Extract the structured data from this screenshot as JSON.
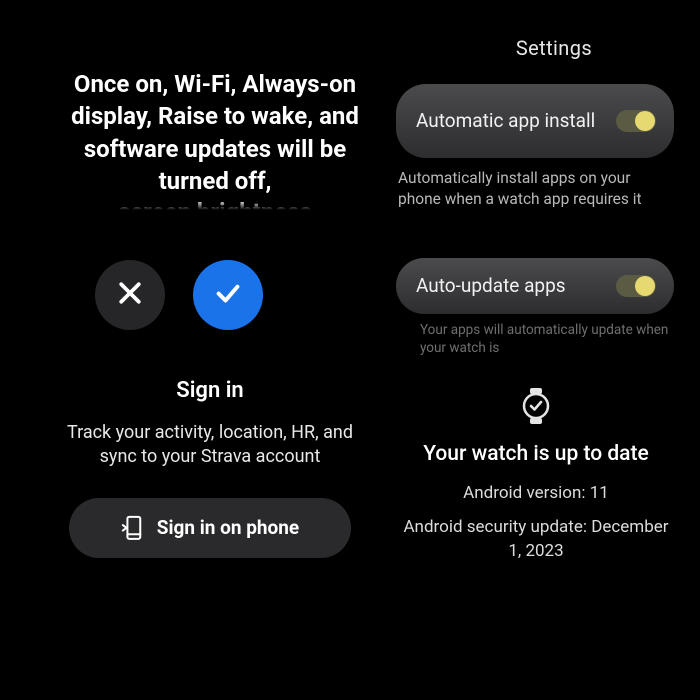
{
  "warning": {
    "text": "Once on, Wi-Fi, Always-on display, Raise to wake, and software updates will be turned off,",
    "fade_text": "screen brightness"
  },
  "signin": {
    "title": "Sign in",
    "subtitle": "Track your activity, location, HR, and sync to your Strava account",
    "button_label": "Sign in on phone"
  },
  "settings": {
    "title": "Settings",
    "items": [
      {
        "label": "Automatic app install",
        "desc": "Automatically install apps on your phone when a watch app requires it",
        "on": true
      },
      {
        "label": "Auto-update apps",
        "desc": "Your apps will automatically update when your watch is",
        "on": true
      }
    ]
  },
  "update": {
    "title": "Your watch is up to date",
    "version_line": "Android version: 11",
    "security_line": "Android security update: December 1, 2023"
  }
}
